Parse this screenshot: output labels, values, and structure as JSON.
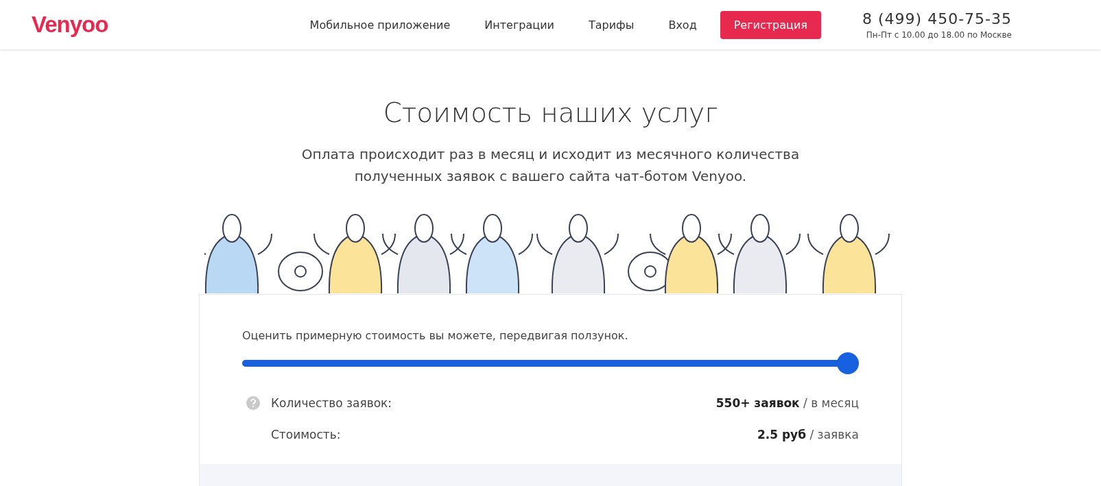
{
  "header": {
    "logo": "Venyoo",
    "nav": [
      "Мобильное приложение",
      "Интеграции",
      "Тарифы",
      "Вход"
    ],
    "register_button": "Регистрация",
    "phone": "8 (499) 450-75-35",
    "hours": "Пн-Пт с 10.00 до 18.00 по Москве"
  },
  "hero": {
    "title": "Стоимость наших услуг",
    "subtitle": "Оплата происходит раз в месяц и исходит из месячного количества полученных заявок с вашего сайта чат-ботом Venyoo."
  },
  "calculator": {
    "hint": "Оценить примерную стоимость вы можете, передвигая ползунок.",
    "slider": {
      "level": 1.0
    },
    "rows": [
      {
        "label": "Количество заявок:",
        "value": "**550+ заявок** / в месяц",
        "help_icon": true
      },
      {
        "label": "Стоимость:",
        "value": "**2.5 руб** / заявка",
        "help_icon": false
      }
    ]
  }
}
